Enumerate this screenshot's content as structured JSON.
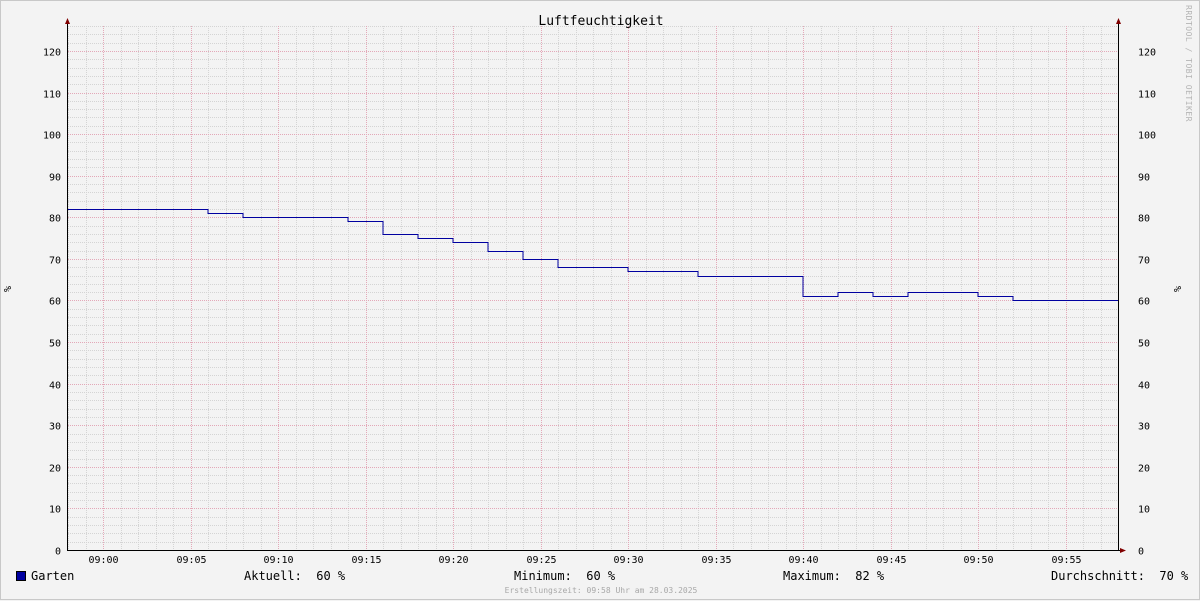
{
  "chart_data": {
    "type": "line",
    "title": "Luftfeuchtigkeit",
    "ylabel": "%",
    "ylim": [
      0,
      126
    ],
    "y_ticks": [
      0,
      10,
      20,
      30,
      40,
      50,
      60,
      70,
      80,
      90,
      100,
      110,
      120
    ],
    "x_ticks": [
      "09:00",
      "09:05",
      "09:10",
      "09:15",
      "09:20",
      "09:25",
      "09:30",
      "09:35",
      "09:40",
      "09:45",
      "09:50",
      "09:55"
    ],
    "x_range": [
      "08:58",
      "09:58"
    ],
    "grid": true,
    "step": true,
    "series": [
      {
        "name": "Garten",
        "color": "#0000a0",
        "x": [
          "08:58",
          "09:06",
          "09:08",
          "09:14",
          "09:16",
          "09:18",
          "09:20",
          "09:22",
          "09:24",
          "09:26",
          "09:28",
          "09:30",
          "09:34",
          "09:40",
          "09:42",
          "09:44",
          "09:46",
          "09:50",
          "09:52",
          "09:58"
        ],
        "values": [
          82,
          81,
          80,
          79,
          76,
          75,
          74,
          72,
          70,
          68,
          68,
          67,
          66,
          61,
          62,
          61,
          62,
          61,
          60,
          60
        ]
      }
    ]
  },
  "legend": {
    "series_name": "Garten",
    "aktuell": "Aktuell:  60 %",
    "minimum": "Minimum:  60 %",
    "maximum": "Maximum:  82 %",
    "durchschnitt": "Durchschnitt:  70 %"
  },
  "watermark": "RRDTOOL / TOBI OETIKER",
  "footer": "Erstellungszeit: 09:58 Uhr am 28.03.2025",
  "colors": {
    "background": "#f3f3f3",
    "major_grid": "#e3a8b8",
    "minor_grid": "#d4d4d4",
    "series": "#0000a0",
    "axis_arrow": "#800000"
  }
}
